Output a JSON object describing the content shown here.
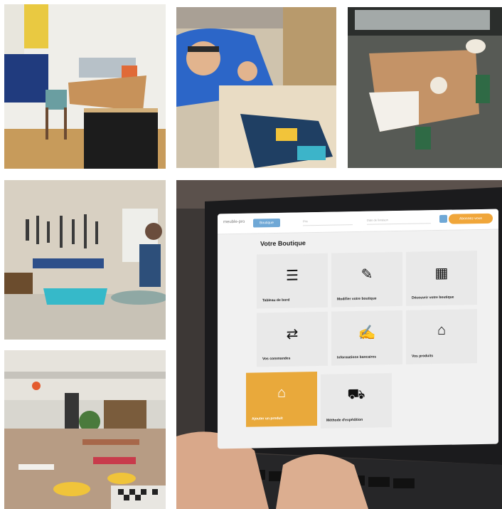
{
  "collage": {
    "photos": [
      "workshop-desk-photo",
      "carpenter-measuring-photo",
      "dining-table-photo",
      "tool-wall-workshop-photo",
      "laptop-shop-admin-photo",
      "cafe-interior-photo"
    ]
  },
  "screen": {
    "logo": "meuble-pro",
    "menu_pill": "Boutique",
    "input1": "Prix",
    "input2": "Date de livraison",
    "cta": "Abonnez-vous",
    "page_title": "Votre Boutique",
    "cards": [
      {
        "label": "Tableau de bord",
        "icon": "list-icon"
      },
      {
        "label": "Modifier votre boutique",
        "icon": "pencil-icon"
      },
      {
        "label": "Découvrir votre boutique",
        "icon": "store-icon"
      },
      {
        "label": "Vos commandes",
        "icon": "exchange-icon"
      },
      {
        "label": "Informations bancaires",
        "icon": "bank-form-icon"
      },
      {
        "label": "Vos produits",
        "icon": "sofa-icon"
      },
      {
        "label": "Ajouter un produit",
        "icon": "sofa-icon"
      },
      {
        "label": "Méthode d'expédition",
        "icon": "truck-icon"
      }
    ]
  },
  "colors": {
    "accent_orange": "#e9a93b",
    "accent_blue": "#6fa8d6"
  }
}
